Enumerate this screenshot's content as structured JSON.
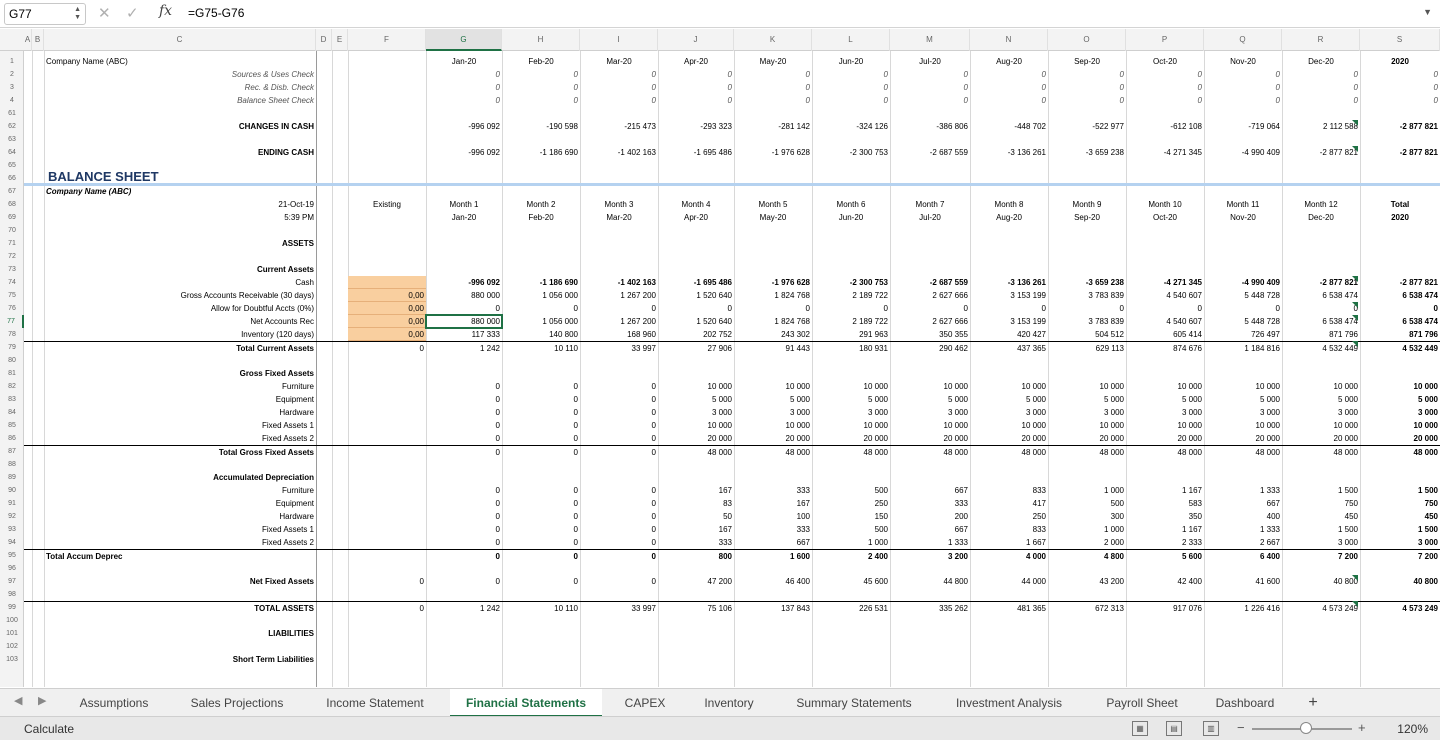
{
  "formula_bar": {
    "name_box": "G77",
    "fx_label": "fx",
    "formula": "=G75-G76"
  },
  "col_letters": [
    "A",
    "B",
    "C",
    "D",
    "E",
    "F",
    "G",
    "H",
    "I",
    "J",
    "K",
    "L",
    "M",
    "N",
    "O",
    "P",
    "Q",
    "R",
    "S"
  ],
  "row_numbers": [
    "1",
    "2",
    "3",
    "4",
    "61",
    "62",
    "63",
    "64",
    "65",
    "66",
    "67",
    "68",
    "69",
    "70",
    "71",
    "72",
    "73",
    "74",
    "75",
    "76",
    "77",
    "78",
    "79",
    "80",
    "81",
    "82",
    "83",
    "84",
    "85",
    "86",
    "87",
    "88",
    "89",
    "90",
    "91",
    "92",
    "93",
    "94",
    "95",
    "96",
    "97",
    "98",
    "99",
    "100",
    "101",
    "102",
    "103"
  ],
  "months": [
    "Jan-20",
    "Feb-20",
    "Mar-20",
    "Apr-20",
    "May-20",
    "Jun-20",
    "Jul-20",
    "Aug-20",
    "Sep-20",
    "Oct-20",
    "Nov-20",
    "Dec-20",
    "2020"
  ],
  "header_row": {
    "company": "Company Name (ABC)"
  },
  "checks": [
    {
      "label": "Sources & Uses Check",
      "vals": [
        "0",
        "0",
        "0",
        "0",
        "0",
        "0",
        "0",
        "0",
        "0",
        "0",
        "0",
        "0",
        "0"
      ]
    },
    {
      "label": "Rec. & Disb. Check",
      "vals": [
        "0",
        "0",
        "0",
        "0",
        "0",
        "0",
        "0",
        "0",
        "0",
        "0",
        "0",
        "0",
        "0"
      ]
    },
    {
      "label": "Balance Sheet Check",
      "vals": [
        "0",
        "0",
        "0",
        "0",
        "0",
        "0",
        "0",
        "0",
        "0",
        "0",
        "0",
        "0",
        "0"
      ]
    }
  ],
  "cash_rows": [
    {
      "label": "CHANGES IN CASH",
      "vals": [
        "-996 092",
        "-190 598",
        "-215 473",
        "-293 323",
        "-281 142",
        "-324 126",
        "-386 806",
        "-448 702",
        "-522 977",
        "-612 108",
        "-719 064",
        "2 112 588",
        "-2 877 821"
      ]
    },
    {
      "label": "ENDING CASH",
      "vals": [
        "-996 092",
        "-1 186 690",
        "-1 402 163",
        "-1 695 486",
        "-1 976 628",
        "-2 300 753",
        "-2 687 559",
        "-3 136 261",
        "-3 659 238",
        "-4 271 345",
        "-4 990 409",
        "-2 877 821",
        "-2 877 821"
      ]
    }
  ],
  "balance_sheet": {
    "title": "BALANCE SHEET",
    "company": "Company Name (ABC)",
    "date": "21-Oct-19",
    "time": "5:39 PM",
    "existing": "Existing",
    "month_labels": [
      "Month 1",
      "Month 2",
      "Month 3",
      "Month 4",
      "Month 5",
      "Month 6",
      "Month 7",
      "Month 8",
      "Month 9",
      "Month 10",
      "Month 11",
      "Month 12",
      "Total"
    ]
  },
  "assets_label": "ASSETS",
  "current_assets": {
    "heading": "Current Assets",
    "rows": [
      {
        "label": "Cash",
        "existing": "",
        "vals": [
          "-996 092",
          "-1 186 690",
          "-1 402 163",
          "-1 695 486",
          "-1 976 628",
          "-2 300 753",
          "-2 687 559",
          "-3 136 261",
          "-3 659 238",
          "-4 271 345",
          "-4 990 409",
          "-2 877 821",
          "-2 877 821"
        ]
      },
      {
        "label": "Gross Accounts Receivable (30 days)",
        "existing": "0,00",
        "vals": [
          "880 000",
          "1 056 000",
          "1 267 200",
          "1 520 640",
          "1 824 768",
          "2 189 722",
          "2 627 666",
          "3 153 199",
          "3 783 839",
          "4 540 607",
          "5 448 728",
          "6 538 474",
          "6 538 474"
        ]
      },
      {
        "label": "Allow for Doubtful Accts (0%)",
        "existing": "0,00",
        "vals": [
          "0",
          "0",
          "0",
          "0",
          "0",
          "0",
          "0",
          "0",
          "0",
          "0",
          "0",
          "0",
          "0"
        ]
      },
      {
        "label": "Net Accounts Rec",
        "existing": "0,00",
        "vals": [
          "880 000",
          "1 056 000",
          "1 267 200",
          "1 520 640",
          "1 824 768",
          "2 189 722",
          "2 627 666",
          "3 153 199",
          "3 783 839",
          "4 540 607",
          "5 448 728",
          "6 538 474",
          "6 538 474"
        ]
      },
      {
        "label": "Inventory (120 days)",
        "existing": "0,00",
        "vals": [
          "117 333",
          "140 800",
          "168 960",
          "202 752",
          "243 302",
          "291 963",
          "350 355",
          "420 427",
          "504 512",
          "605 414",
          "726 497",
          "871 796",
          "871 796"
        ]
      },
      {
        "label": "Total Current Assets",
        "existing": "0",
        "vals": [
          "1 242",
          "10 110",
          "33 997",
          "27 906",
          "91 443",
          "180 931",
          "290 462",
          "437 365",
          "629 113",
          "874 676",
          "1 184 816",
          "4 532 449",
          "4 532 449"
        ]
      }
    ]
  },
  "gross_fixed": {
    "heading": "Gross Fixed Assets",
    "rows": [
      {
        "label": "Furniture",
        "vals": [
          "0",
          "0",
          "0",
          "10 000",
          "10 000",
          "10 000",
          "10 000",
          "10 000",
          "10 000",
          "10 000",
          "10 000",
          "10 000",
          "10 000"
        ]
      },
      {
        "label": "Equipment",
        "vals": [
          "0",
          "0",
          "0",
          "5 000",
          "5 000",
          "5 000",
          "5 000",
          "5 000",
          "5 000",
          "5 000",
          "5 000",
          "5 000",
          "5 000"
        ]
      },
      {
        "label": "Hardware",
        "vals": [
          "0",
          "0",
          "0",
          "3 000",
          "3 000",
          "3 000",
          "3 000",
          "3 000",
          "3 000",
          "3 000",
          "3 000",
          "3 000",
          "3 000"
        ]
      },
      {
        "label": "Fixed Assets 1",
        "vals": [
          "0",
          "0",
          "0",
          "10 000",
          "10 000",
          "10 000",
          "10 000",
          "10 000",
          "10 000",
          "10 000",
          "10 000",
          "10 000",
          "10 000"
        ]
      },
      {
        "label": "Fixed Assets 2",
        "vals": [
          "0",
          "0",
          "0",
          "20 000",
          "20 000",
          "20 000",
          "20 000",
          "20 000",
          "20 000",
          "20 000",
          "20 000",
          "20 000",
          "20 000"
        ]
      },
      {
        "label": "Total Gross Fixed Assets",
        "vals": [
          "0",
          "0",
          "0",
          "48 000",
          "48 000",
          "48 000",
          "48 000",
          "48 000",
          "48 000",
          "48 000",
          "48 000",
          "48 000",
          "48 000"
        ]
      }
    ]
  },
  "accum_dep": {
    "heading": "Accumulated Depreciation",
    "rows": [
      {
        "label": "Furniture",
        "vals": [
          "0",
          "0",
          "0",
          "167",
          "333",
          "500",
          "667",
          "833",
          "1 000",
          "1 167",
          "1 333",
          "1 500",
          "1 500"
        ]
      },
      {
        "label": "Equipment",
        "vals": [
          "0",
          "0",
          "0",
          "83",
          "167",
          "250",
          "333",
          "417",
          "500",
          "583",
          "667",
          "750",
          "750"
        ]
      },
      {
        "label": "Hardware",
        "vals": [
          "0",
          "0",
          "0",
          "50",
          "100",
          "150",
          "200",
          "250",
          "300",
          "350",
          "400",
          "450",
          "450"
        ]
      },
      {
        "label": "Fixed Assets 1",
        "vals": [
          "0",
          "0",
          "0",
          "167",
          "333",
          "500",
          "667",
          "833",
          "1 000",
          "1 167",
          "1 333",
          "1 500",
          "1 500"
        ]
      },
      {
        "label": "Fixed Assets 2",
        "vals": [
          "0",
          "0",
          "0",
          "333",
          "667",
          "1 000",
          "1 333",
          "1 667",
          "2 000",
          "2 333",
          "2 667",
          "3 000",
          "3 000"
        ]
      },
      {
        "label": "Total Accum Deprec",
        "vals": [
          "0",
          "0",
          "0",
          "800",
          "1 600",
          "2 400",
          "3 200",
          "4 000",
          "4 800",
          "5 600",
          "6 400",
          "7 200",
          "7 200"
        ]
      }
    ]
  },
  "net_fixed": {
    "label": "Net Fixed Assets",
    "existing": "0",
    "vals": [
      "0",
      "0",
      "0",
      "47 200",
      "46 400",
      "45 600",
      "44 800",
      "44 000",
      "43 200",
      "42 400",
      "41 600",
      "40 800",
      "40 800"
    ]
  },
  "total_assets": {
    "label": "TOTAL ASSETS",
    "existing": "0",
    "vals": [
      "1 242",
      "10 110",
      "33 997",
      "75 106",
      "137 843",
      "226 531",
      "335 262",
      "481 365",
      "672 313",
      "917 076",
      "1 226 416",
      "4 573 249",
      "4 573 249"
    ]
  },
  "liabilities_label": "LIABILITIES",
  "short_term_label": "Short Term Liabilities",
  "tabs": [
    "Assumptions",
    "Sales Projections",
    "Income Statement",
    "Financial Statements",
    "CAPEX",
    "Inventory",
    "Summary Statements",
    "Investment Analysis",
    "Payroll Sheet",
    "Dashboard",
    "+"
  ],
  "active_tab": "Financial Statements",
  "status": {
    "mode": "Calculate",
    "zoom": "120%"
  },
  "colors": {
    "accent": "#1f7145",
    "input_fill": "#f9cf9f",
    "title": "#1f3864"
  }
}
